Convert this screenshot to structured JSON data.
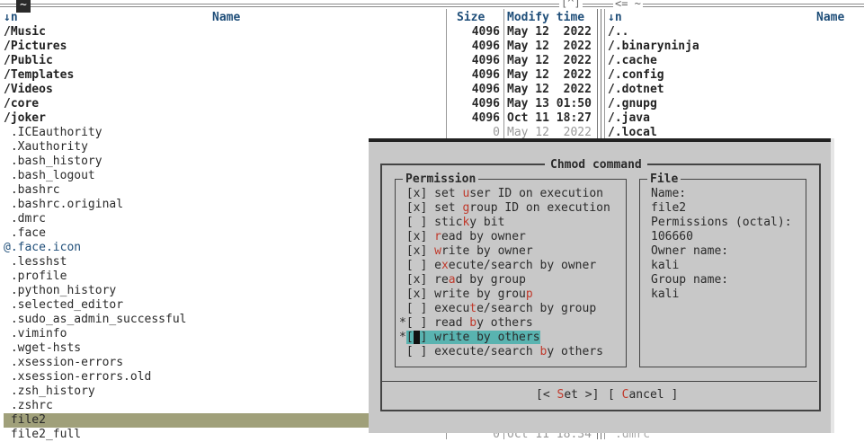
{
  "top_bar": {
    "left_tab": "~",
    "center_marker": "[^]",
    "right_marker": "<= ~"
  },
  "left_panel": {
    "headers": {
      "sort": "↓n",
      "name": "Name",
      "size": "Size",
      "mtime": "Modify time"
    },
    "rows": [
      {
        "name": "/Music",
        "size": "4096",
        "mtime": "May 12  2022"
      },
      {
        "name": "/Pictures",
        "size": "4096",
        "mtime": "May 12  2022"
      },
      {
        "name": "/Public",
        "size": "4096",
        "mtime": "May 12  2022"
      },
      {
        "name": "/Templates",
        "size": "4096",
        "mtime": "May 12  2022"
      },
      {
        "name": "/Videos",
        "size": "4096",
        "mtime": "May 12  2022"
      },
      {
        "name": "/core",
        "size": "4096",
        "mtime": "May 13 01:50"
      },
      {
        "name": "/joker",
        "size": "4096",
        "mtime": "Oct 11 18:27"
      },
      {
        "name": " .ICEauthority",
        "size": "0",
        "mtime": "May 12  2022"
      },
      {
        "name": " .Xauthority"
      },
      {
        "name": " .bash_history"
      },
      {
        "name": " .bash_logout"
      },
      {
        "name": " .bashrc"
      },
      {
        "name": " .bashrc.original"
      },
      {
        "name": " .dmrc"
      },
      {
        "name": " .face"
      },
      {
        "name": "@.face.icon"
      },
      {
        "name": " .lesshst"
      },
      {
        "name": " .profile"
      },
      {
        "name": " .python_history"
      },
      {
        "name": " .selected_editor"
      },
      {
        "name": " .sudo_as_admin_successful"
      },
      {
        "name": " .viminfo"
      },
      {
        "name": " .wget-hsts"
      },
      {
        "name": " .xsession-errors"
      },
      {
        "name": " .xsession-errors.old"
      },
      {
        "name": " .zsh_history"
      },
      {
        "name": " .zshrc"
      },
      {
        "name": " file2"
      },
      {
        "name": " file2_full",
        "size": "0",
        "mtime": "Oct 11 18:34"
      }
    ]
  },
  "right_panel": {
    "headers": {
      "sort": "↓n",
      "name": "Name"
    },
    "rows": [
      "/..",
      "/.binaryninja",
      "/.cache",
      "/.config",
      "/.dotnet",
      "/.gnupg",
      "/.java",
      "/.local"
    ],
    "bottom_row": ".dmrc"
  },
  "dialog": {
    "title": "Chmod command",
    "permission_group_title": "Permission",
    "permissions": [
      {
        "mark": " ",
        "box": "[x]",
        "label_pre": "set ",
        "hot": "u",
        "label_post": "ser ID on execution"
      },
      {
        "mark": " ",
        "box": "[x]",
        "label_pre": "set ",
        "hot": "g",
        "label_post": "roup ID on execution"
      },
      {
        "mark": " ",
        "box": "[ ]",
        "label_pre": "stic",
        "hot": "k",
        "label_post": "y bit"
      },
      {
        "mark": " ",
        "box": "[x]",
        "label_pre": "",
        "hot": "r",
        "label_post": "ead by owner"
      },
      {
        "mark": " ",
        "box": "[x]",
        "label_pre": "",
        "hot": "w",
        "label_post": "rite by owner"
      },
      {
        "mark": " ",
        "box": "[ ]",
        "label_pre": "e",
        "hot": "x",
        "label_post": "ecute/search by owner"
      },
      {
        "mark": " ",
        "box": "[x]",
        "label_pre": "re",
        "hot": "a",
        "label_post": "d by group"
      },
      {
        "mark": " ",
        "box": "[x]",
        "label_pre": "write by grou",
        "hot": "p",
        "label_post": ""
      },
      {
        "mark": " ",
        "box": "[ ]",
        "label_pre": "execu",
        "hot": "t",
        "label_post": "e/search by group"
      },
      {
        "mark": "*",
        "box": "[ ]",
        "label_pre": "read ",
        "hot": "b",
        "label_post": "y others"
      },
      {
        "mark": "*",
        "box": "[ ]",
        "label_pre": "write by others",
        "hot": "",
        "label_post": ""
      },
      {
        "mark": " ",
        "box": "[ ]",
        "label_pre": "execute/search ",
        "hot": "b",
        "label_post": "y others"
      }
    ],
    "file_group_title": "File",
    "file_info": [
      "Name:",
      "file2",
      "Permissions (octal):",
      "106660",
      "Owner name:",
      "kali",
      "Group name:",
      "kali"
    ],
    "buttons": {
      "set_pre": "[< ",
      "set_hot": "S",
      "set_post": "et >]",
      "cancel_pre": "[ ",
      "cancel_hot": "C",
      "cancel_post": "ancel ]"
    }
  }
}
